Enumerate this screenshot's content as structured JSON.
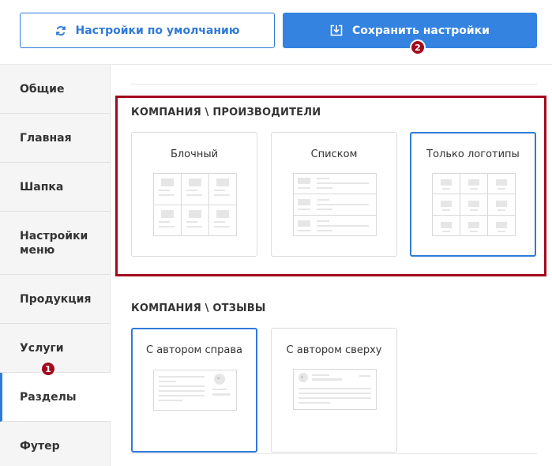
{
  "toolbar": {
    "default_label": "Настройки по умолчанию",
    "save_label": "Сохранить настройки"
  },
  "sidebar": {
    "items": [
      {
        "label": "Общие"
      },
      {
        "label": "Главная"
      },
      {
        "label": "Шапка"
      },
      {
        "label": "Настройки меню"
      },
      {
        "label": "Продукция"
      },
      {
        "label": "Услуги"
      },
      {
        "label": "Разделы",
        "active": true
      },
      {
        "label": "Футер"
      }
    ]
  },
  "sections": [
    {
      "title": "КОМПАНИЯ \\ ПРОИЗВОДИТЕЛИ",
      "options": [
        {
          "label": "Блочный",
          "selected": false
        },
        {
          "label": "Списком",
          "selected": false
        },
        {
          "label": "Только логотипы",
          "selected": true
        }
      ]
    },
    {
      "title": "КОМПАНИЯ \\ ОТЗЫВЫ",
      "options": [
        {
          "label": "С автором справа",
          "selected": true
        },
        {
          "label": "С автором сверху",
          "selected": false
        }
      ]
    }
  ],
  "badges": [
    "1",
    "2"
  ],
  "colors": {
    "accent": "#2f7ad8",
    "highlight": "#a30a1c"
  }
}
